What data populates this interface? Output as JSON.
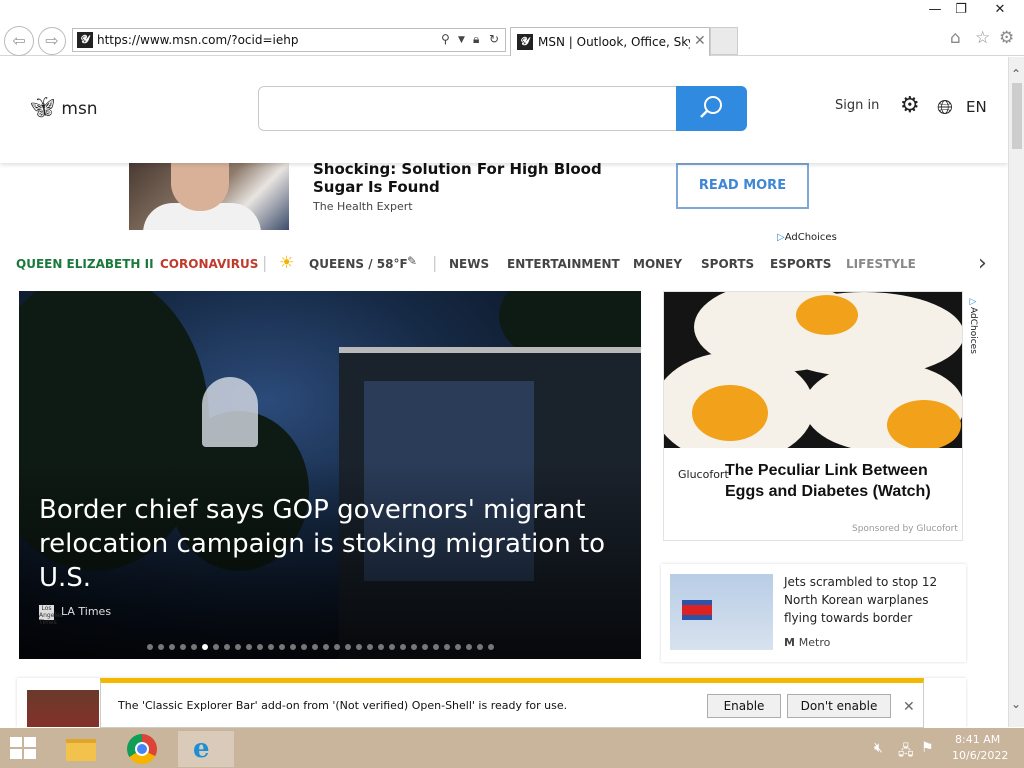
{
  "window": {
    "minimize": "—",
    "restore": "❐",
    "close": "✕"
  },
  "address_bar": {
    "url": "https://www.msn.com/?ocid=iehp",
    "favicon": "msn-favicon"
  },
  "tabs": [
    {
      "title": "MSN | Outlook, Office, Sky...",
      "close": "✕"
    }
  ],
  "toolbar": {
    "home": "⌂",
    "favorites": "☆",
    "settings": "⚙"
  },
  "header": {
    "logo_text": "msn",
    "sign_in": "Sign in",
    "language": "EN"
  },
  "top_ad": {
    "title": "Shocking: Solution For High Blood Sugar Is Found",
    "source": "The Health Expert",
    "cta": "READ MORE",
    "adchoices": "AdChoices"
  },
  "nav": {
    "items": [
      "QUEEN ELIZABETH II",
      "CORONAVIRUS",
      "QUEENS / 58°F",
      "NEWS",
      "ENTERTAINMENT",
      "MONEY",
      "SPORTS",
      "ESPORTS",
      "LIFESTYLE"
    ],
    "colors": {
      "trending": "#1a7a3c",
      "alert": "#c0392b",
      "default": "#444444"
    },
    "next": "›"
  },
  "hero": {
    "title": "Border chief says GOP governors' migrant relocation campaign is stoking migration to U.S.",
    "source": "LA Times",
    "source_logo_text": "Los Angeles Times",
    "slides_total": 32,
    "slide_current": 5
  },
  "side_ad": {
    "brand": "Glucofort",
    "title": "The Peculiar Link Between Eggs and Diabetes (Watch)",
    "sponsored": "Sponsored by Glucofort",
    "adchoices": "AdChoices"
  },
  "side_story": {
    "title": "Jets scrambled to stop 12 North Korean warplanes flying towards border",
    "source": "Metro"
  },
  "notification": {
    "text": "The 'Classic Explorer Bar' add-on from '(Not verified) Open-Shell' is ready for use.",
    "enable": "Enable",
    "dont_enable": "Don't enable",
    "close": "✕"
  },
  "taskbar": {
    "time": "8:41 AM",
    "date": "10/6/2022",
    "apps": [
      "file-explorer",
      "chrome",
      "internet-explorer"
    ],
    "accent": "#c9b49c"
  }
}
